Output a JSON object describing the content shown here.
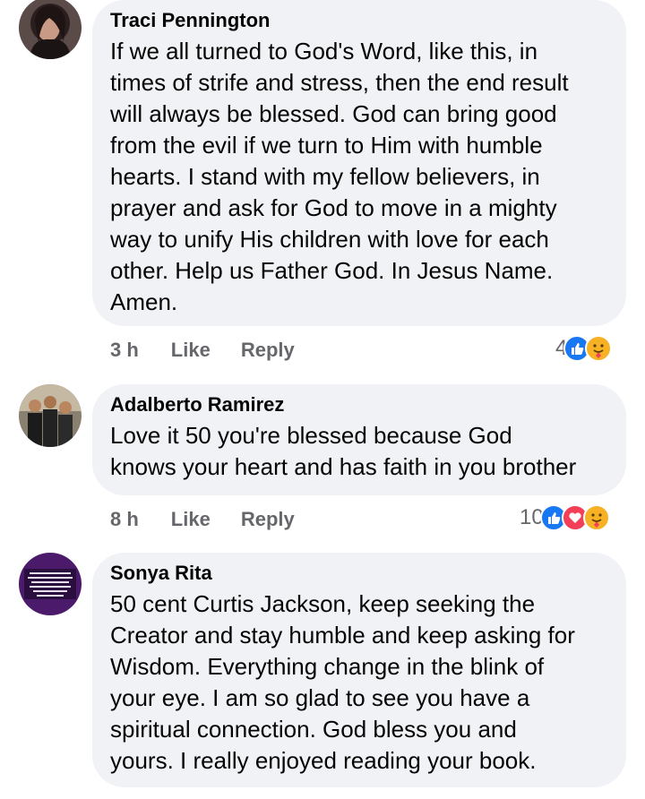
{
  "comments": [
    {
      "author": "Traci Pennington",
      "lines": [
        "If we all turned to God's Word, like this, in",
        "times of strife and stress, then the end result",
        "will always be blessed. God can bring good",
        "from the evil if we turn to Him with humble",
        "hearts. I stand with my fellow believers, in",
        "prayer and ask for God to move in a mighty",
        "way to unify His children with love for each",
        "other. Help us Father God. In Jesus Name.",
        "Amen."
      ],
      "time": "3 h",
      "like_label": "Like",
      "reply_label": "Reply",
      "reaction_count": "4",
      "reactions": [
        "like-icon",
        "care-icon"
      ]
    },
    {
      "author": "Adalberto Ramirez",
      "lines": [
        "Love it 50 you're blessed because God",
        "knows your heart and has faith in you brother"
      ],
      "time": "8 h",
      "like_label": "Like",
      "reply_label": "Reply",
      "reaction_count": "10",
      "reactions": [
        "like-icon",
        "love-icon",
        "care-icon"
      ]
    },
    {
      "author": "Sonya Rita",
      "lines": [
        "50 cent Curtis Jackson, keep seeking the",
        "Creator and stay humble and keep asking for",
        "Wisdom. Everything change in the blink of",
        "your eye. I am so glad to see you have a",
        "spiritual connection.  God bless you and",
        "yours. I really enjoyed reading your book."
      ]
    }
  ],
  "colors": {
    "bubble": "#f0f2f5",
    "meta_text": "#65676b",
    "like_blue": "#1877f2",
    "love_red": "#f33e58",
    "care_yellow": "#f7b125"
  }
}
